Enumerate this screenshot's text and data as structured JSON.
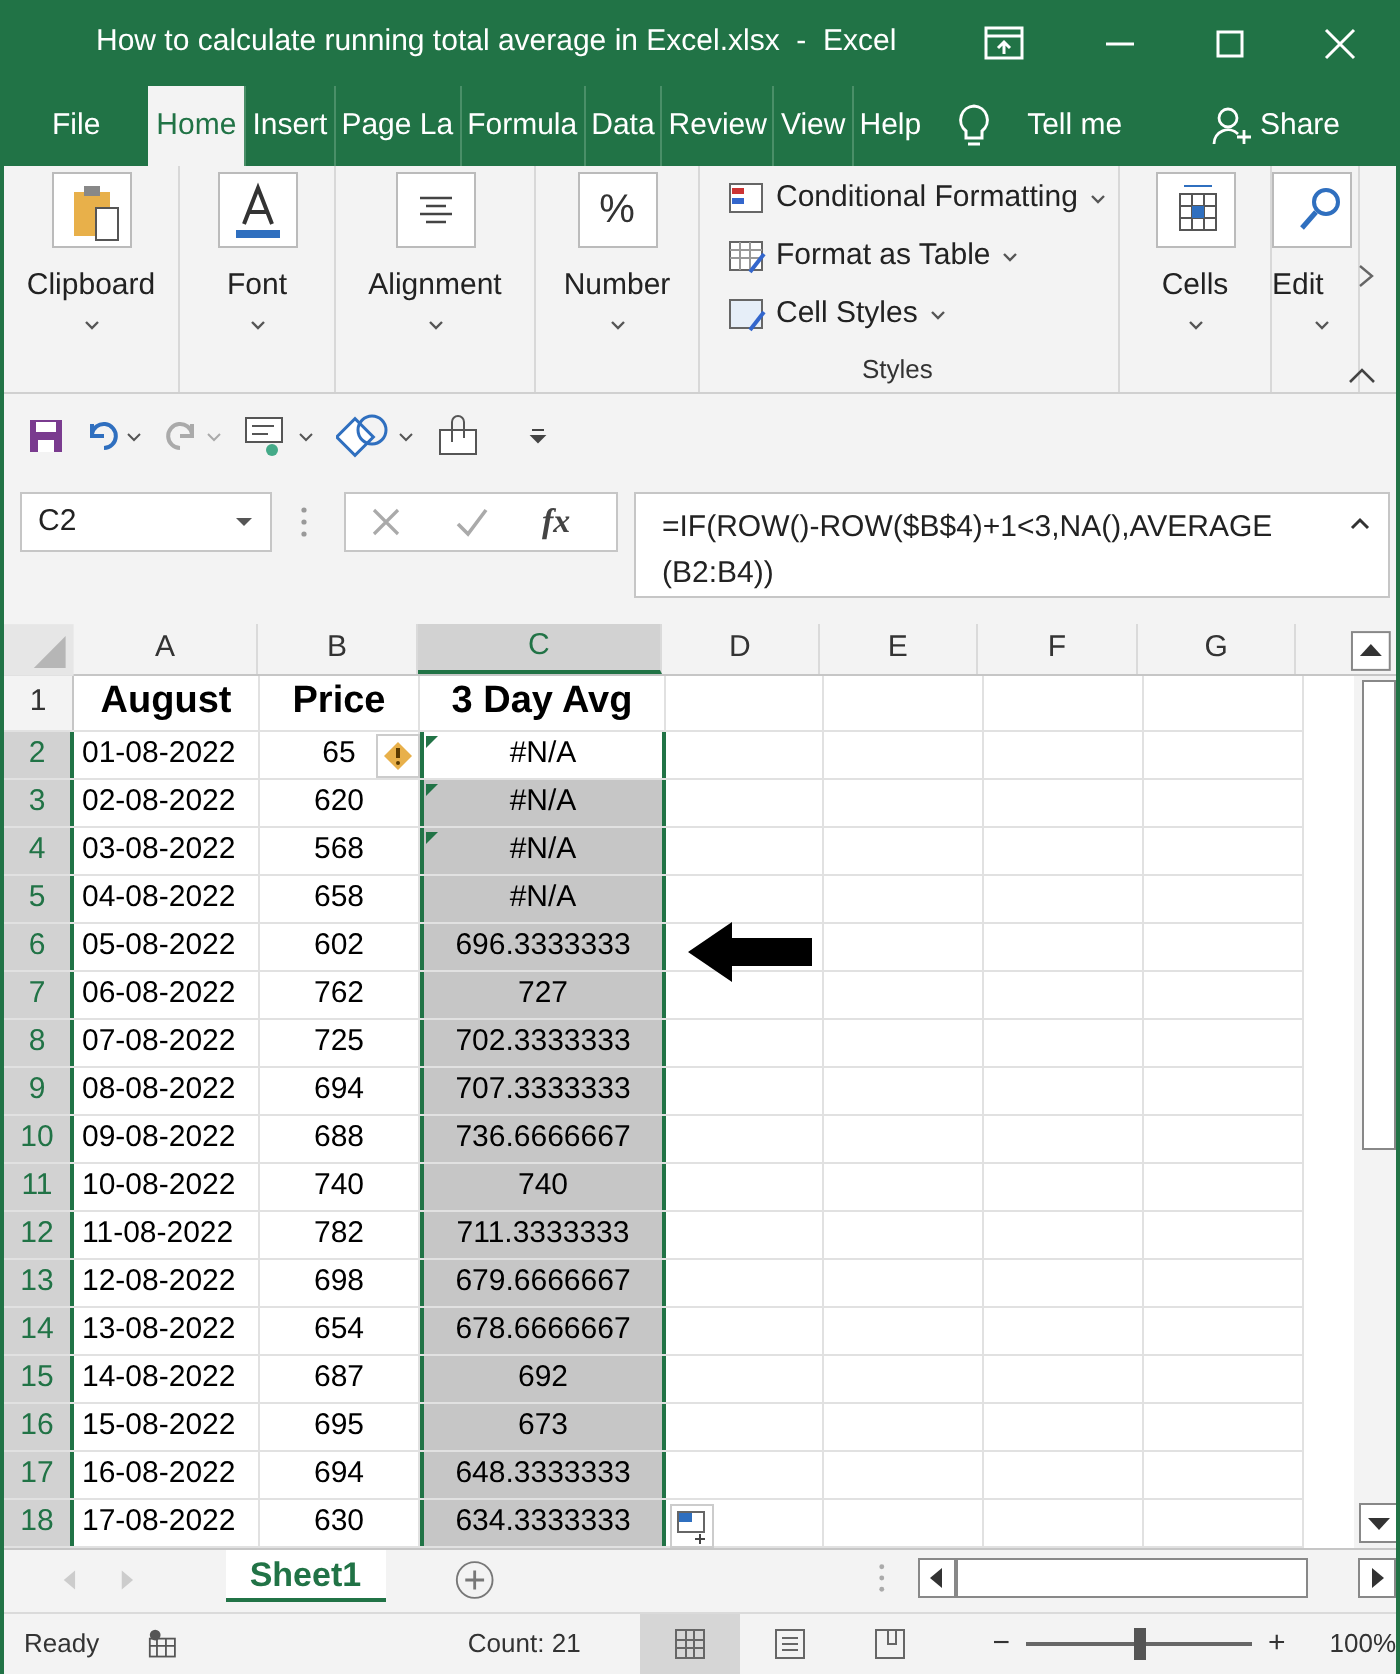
{
  "window": {
    "title": "How to calculate running total average in Excel.xlsx  -  Excel"
  },
  "menu_tabs": [
    {
      "label": "File",
      "selected": false
    },
    {
      "label": "Home",
      "selected": true
    },
    {
      "label": "Insert",
      "selected": false
    },
    {
      "label": "Page La",
      "selected": false
    },
    {
      "label": "Formula",
      "selected": false
    },
    {
      "label": "Data",
      "selected": false
    },
    {
      "label": "Review",
      "selected": false
    },
    {
      "label": "View",
      "selected": false
    },
    {
      "label": "Help",
      "selected": false
    }
  ],
  "tell_me": "Tell me",
  "share": "Share",
  "ribbon": {
    "groups": [
      {
        "kind": "big",
        "label": "Clipboard"
      },
      {
        "kind": "big",
        "label": "Font"
      },
      {
        "kind": "big",
        "label": "Alignment"
      },
      {
        "kind": "big",
        "label": "Number",
        "glyph": "%"
      },
      {
        "kind": "styles",
        "label": "Styles",
        "items": [
          "Conditional Formatting",
          "Format as Table",
          "Cell Styles"
        ]
      },
      {
        "kind": "big",
        "label": "Cells"
      },
      {
        "kind": "big",
        "label": "Edit"
      }
    ]
  },
  "name_box": "C2",
  "fx": "fx",
  "formula": "=IF(ROW()-ROW($B$4)+1<3,NA(),AVERAGE(B2:B4))",
  "columns": [
    {
      "label": "A",
      "selected": false
    },
    {
      "label": "B",
      "selected": false
    },
    {
      "label": "C",
      "selected": true
    },
    {
      "label": "D",
      "selected": false
    },
    {
      "label": "E",
      "selected": false
    },
    {
      "label": "F",
      "selected": false
    },
    {
      "label": "G",
      "selected": false
    }
  ],
  "header_row": {
    "number": "1",
    "cells": [
      "August",
      "Price",
      "3 Day Avg"
    ]
  },
  "rows": [
    {
      "number": "2",
      "date": "01-08-2022",
      "price": "65",
      "avg": "#N/A",
      "active": true,
      "selected": true,
      "flag": true,
      "warning": true
    },
    {
      "number": "3",
      "date": "02-08-2022",
      "price": "620",
      "avg": "#N/A",
      "active": false,
      "selected": true,
      "flag": true,
      "warning": false
    },
    {
      "number": "4",
      "date": "03-08-2022",
      "price": "568",
      "avg": "#N/A",
      "active": false,
      "selected": true,
      "flag": true,
      "warning": false
    },
    {
      "number": "5",
      "date": "04-08-2022",
      "price": "658",
      "avg": "#N/A",
      "active": false,
      "selected": true,
      "flag": false,
      "warning": false
    },
    {
      "number": "6",
      "date": "05-08-2022",
      "price": "602",
      "avg": "696.3333333",
      "active": false,
      "selected": true,
      "flag": false,
      "warning": false
    },
    {
      "number": "7",
      "date": "06-08-2022",
      "price": "762",
      "avg": "727",
      "active": false,
      "selected": true,
      "flag": false,
      "warning": false
    },
    {
      "number": "8",
      "date": "07-08-2022",
      "price": "725",
      "avg": "702.3333333",
      "active": false,
      "selected": true,
      "flag": false,
      "warning": false
    },
    {
      "number": "9",
      "date": "08-08-2022",
      "price": "694",
      "avg": "707.3333333",
      "active": false,
      "selected": true,
      "flag": false,
      "warning": false
    },
    {
      "number": "10",
      "date": "09-08-2022",
      "price": "688",
      "avg": "736.6666667",
      "active": false,
      "selected": true,
      "flag": false,
      "warning": false
    },
    {
      "number": "11",
      "date": "10-08-2022",
      "price": "740",
      "avg": "740",
      "active": false,
      "selected": true,
      "flag": false,
      "warning": false
    },
    {
      "number": "12",
      "date": "11-08-2022",
      "price": "782",
      "avg": "711.3333333",
      "active": false,
      "selected": true,
      "flag": false,
      "warning": false
    },
    {
      "number": "13",
      "date": "12-08-2022",
      "price": "698",
      "avg": "679.6666667",
      "active": false,
      "selected": true,
      "flag": false,
      "warning": false
    },
    {
      "number": "14",
      "date": "13-08-2022",
      "price": "654",
      "avg": "678.6666667",
      "active": false,
      "selected": true,
      "flag": false,
      "warning": false
    },
    {
      "number": "15",
      "date": "14-08-2022",
      "price": "687",
      "avg": "692",
      "active": false,
      "selected": true,
      "flag": false,
      "warning": false
    },
    {
      "number": "16",
      "date": "15-08-2022",
      "price": "695",
      "avg": "673",
      "active": false,
      "selected": true,
      "flag": false,
      "warning": false
    },
    {
      "number": "17",
      "date": "16-08-2022",
      "price": "694",
      "avg": "648.3333333",
      "active": false,
      "selected": true,
      "flag": false,
      "warning": false
    },
    {
      "number": "18",
      "date": "17-08-2022",
      "price": "630",
      "avg": "634.3333333",
      "active": false,
      "selected": true,
      "flag": false,
      "warning": false
    }
  ],
  "sheet_tabs": [
    {
      "label": "Sheet1",
      "selected": true
    }
  ],
  "status_bar": {
    "ready": "Ready",
    "count": "Count: 21",
    "views": [
      {
        "kind": "normal",
        "selected": true
      },
      {
        "kind": "layout",
        "selected": false
      },
      {
        "kind": "break",
        "selected": false
      }
    ],
    "zoom_minus": "−",
    "zoom_plus": "+",
    "zoom": {
      "level": 0.5
    },
    "zoom_label": "100%"
  }
}
